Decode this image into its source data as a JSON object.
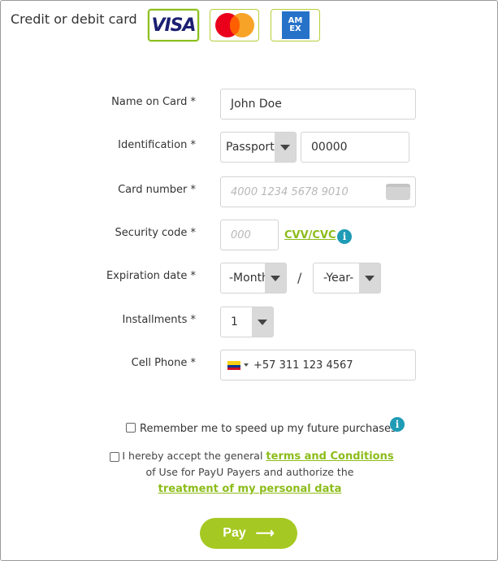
{
  "payment_method": {
    "title": "Credit or debit card",
    "cards": [
      {
        "name": "VISA",
        "icon": "visa-logo",
        "selected": true
      },
      {
        "name": "Mastercard",
        "icon": "mastercard-logo",
        "selected": false
      },
      {
        "name": "AMEX",
        "icon": "amex-logo",
        "selected": false
      }
    ],
    "amex_line1": "AM",
    "amex_line2": "EX"
  },
  "form": {
    "name_label": "Name on Card *",
    "name_value": "John Doe",
    "id_label": "Identification *",
    "id_type": "Passport",
    "id_number": "00000",
    "card_label": "Card number *",
    "card_placeholder": "4000 1234 5678 9010",
    "security_label": "Security code *",
    "security_placeholder": "000",
    "cvv_link": "CVV/CVC",
    "expiration_label": "Expiration date *",
    "month_value": "-Month-",
    "separator": "/",
    "year_value": "-Year-",
    "installments_label": "Installments *",
    "installments_value": "1",
    "phone_label": "Cell Phone *",
    "phone_value": "+57 311 123 4567"
  },
  "remember": {
    "label": "Remember me to speed up my future purchases"
  },
  "terms": {
    "prefix": "I hereby accept the general ",
    "link1": "terms and Conditions",
    "middle": "of Use for PayU Payers and authorize the",
    "link2": "treatment of my personal data"
  },
  "pay_button": {
    "label": "Pay",
    "arrow": "⟶"
  },
  "colors": {
    "accent_green": "#a6c822",
    "link_green": "#8cbc1a",
    "info_blue": "#1f9bb5"
  }
}
